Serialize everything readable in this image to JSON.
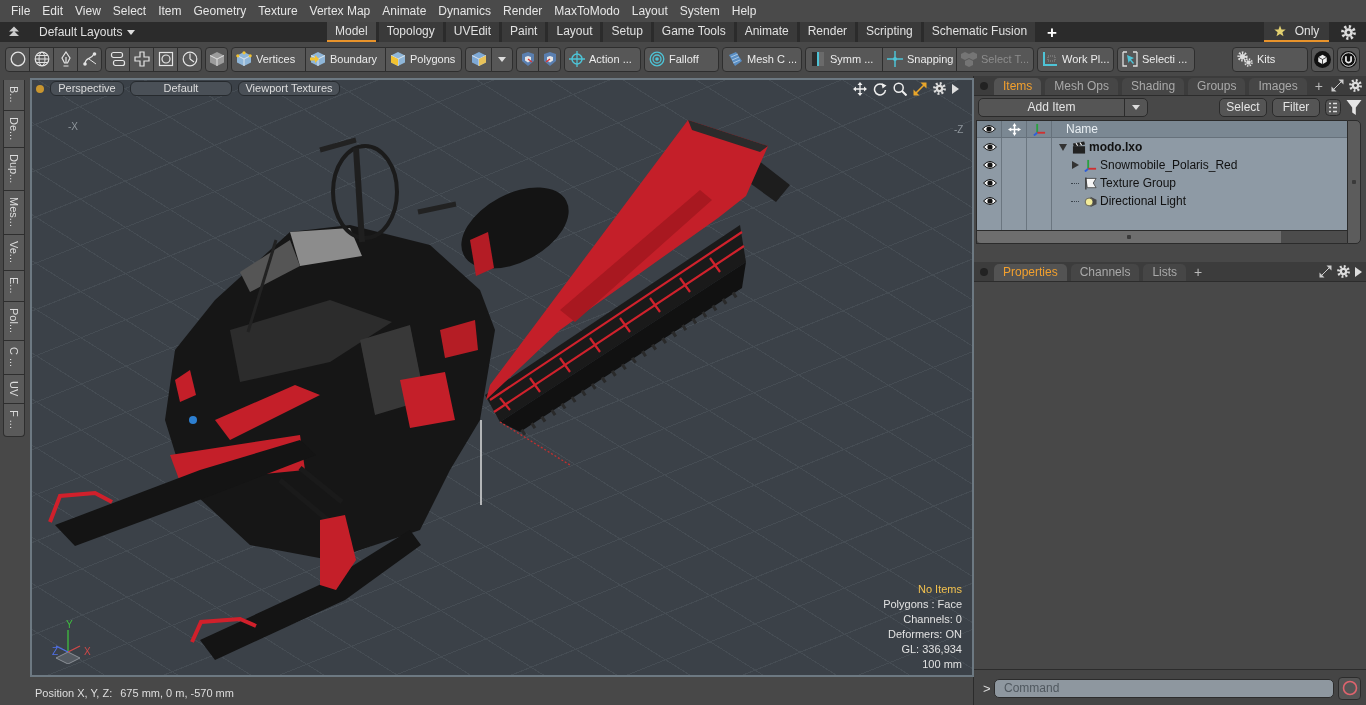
{
  "menu_bar": [
    "File",
    "Edit",
    "View",
    "Select",
    "Item",
    "Geometry",
    "Texture",
    "Vertex Map",
    "Animate",
    "Dynamics",
    "Render",
    "MaxToModo",
    "Layout",
    "System",
    "Help"
  ],
  "layout_bar": {
    "layouts_dropdown": "Default Layouts",
    "tabs": [
      {
        "label": "Model",
        "selected": true
      },
      {
        "label": "Topology",
        "selected": false
      },
      {
        "label": "UVEdit",
        "selected": false
      },
      {
        "label": "Paint",
        "selected": false
      },
      {
        "label": "Layout",
        "selected": false
      },
      {
        "label": "Setup",
        "selected": false
      },
      {
        "label": "Game Tools",
        "selected": false
      },
      {
        "label": "Animate",
        "selected": false
      },
      {
        "label": "Render",
        "selected": false
      },
      {
        "label": "Scripting",
        "selected": false
      },
      {
        "label": "Schematic Fusion",
        "selected": false
      }
    ],
    "add_tab": "+",
    "only_button": {
      "label": "Only",
      "selected": true
    }
  },
  "toolbar": {
    "buttons": [
      {
        "label": "Vertices",
        "disabled": false
      },
      {
        "label": "Boundary",
        "disabled": false
      },
      {
        "label": "Polygons",
        "disabled": false
      },
      {
        "label": "Action ...",
        "disabled": false
      },
      {
        "label": "Falloff",
        "disabled": false
      },
      {
        "label": "Mesh C ...",
        "disabled": false
      },
      {
        "label": "Symm ...",
        "disabled": false
      },
      {
        "label": "Snapping",
        "disabled": false
      },
      {
        "label": "Select T...",
        "disabled": true
      },
      {
        "label": "Work Pl...",
        "disabled": false
      },
      {
        "label": "Selecti ...",
        "disabled": false
      }
    ],
    "kits": "Kits"
  },
  "side_tabs": [
    "B...",
    "De...",
    "Dup...",
    "Mes...",
    "Ve...",
    "E...",
    "Pol...",
    "C ...",
    "UV",
    "F ..."
  ],
  "viewport": {
    "view_buttons": [
      "Perspective",
      "Default",
      "Viewport Textures"
    ],
    "axis_labels": [
      "-X",
      "-Z"
    ],
    "info": [
      {
        "text": "No Items",
        "kind": "warning"
      },
      {
        "text": "Polygons : Face",
        "kind": "normal"
      },
      {
        "text": "Channels: 0",
        "kind": "normal"
      },
      {
        "text": "Deformers: ON",
        "kind": "normal"
      },
      {
        "text": "GL: 336,934",
        "kind": "normal"
      },
      {
        "text": "100 mm",
        "kind": "normal"
      }
    ],
    "gizmo": {
      "y": "Y",
      "z": "Z",
      "x": "X"
    }
  },
  "status_bar": {
    "label": "Position X, Y, Z:",
    "value": "675 mm, 0 m, -570 mm"
  },
  "items_panel": {
    "tabs": [
      {
        "label": "Items",
        "selected": true
      },
      {
        "label": "Mesh Ops",
        "selected": false
      },
      {
        "label": "Shading",
        "selected": false
      },
      {
        "label": "Groups",
        "selected": false
      },
      {
        "label": "Images",
        "selected": false
      }
    ],
    "add_tab": "+",
    "add_item": "Add Item",
    "buttons": [
      "Select",
      "Filter"
    ],
    "column_name": "Name",
    "tree": [
      {
        "label": "modo.lxo",
        "kind": "scene",
        "visible": true,
        "expanded": true,
        "children": [
          {
            "label": "Snowmobile_Polaris_Red",
            "kind": "mesh",
            "visible": true,
            "expanded": false
          },
          {
            "label": "Texture Group",
            "kind": "group",
            "visible": true
          },
          {
            "label": "Directional Light",
            "kind": "light",
            "visible": true
          }
        ]
      }
    ]
  },
  "properties_panel": {
    "tabs": [
      {
        "label": "Properties",
        "selected": true
      },
      {
        "label": "Channels",
        "selected": false
      },
      {
        "label": "Lists",
        "selected": false
      }
    ],
    "add_tab": "+"
  },
  "command_bar": {
    "prompt": ">",
    "placeholder": "Command"
  }
}
